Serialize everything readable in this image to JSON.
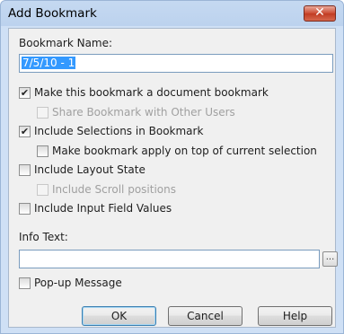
{
  "window": {
    "title": "Add Bookmark",
    "close_glyph": "✕"
  },
  "name_field": {
    "label": "Bookmark Name:",
    "value": "7/5/10 - 1"
  },
  "options": {
    "doc_bookmark": {
      "label": "Make this bookmark a document bookmark",
      "checked": true
    },
    "share_users": {
      "label": "Share Bookmark with Other Users",
      "checked": false,
      "disabled": true
    },
    "include_selections": {
      "label": "Include Selections in Bookmark",
      "checked": true
    },
    "apply_on_top": {
      "label": "Make bookmark apply on top of current selection",
      "checked": false
    },
    "layout_state": {
      "label": "Include Layout State",
      "checked": false
    },
    "scroll_positions": {
      "label": "Include Scroll positions",
      "checked": false,
      "disabled": true
    },
    "input_field_values": {
      "label": "Include Input Field Values",
      "checked": false
    }
  },
  "info": {
    "label": "Info Text:",
    "value": "",
    "browse_label": "..."
  },
  "popup": {
    "label": "Pop-up Message",
    "checked": false
  },
  "buttons": {
    "ok": "OK",
    "cancel": "Cancel",
    "help": "Help"
  },
  "glyphs": {
    "check": "✔"
  }
}
